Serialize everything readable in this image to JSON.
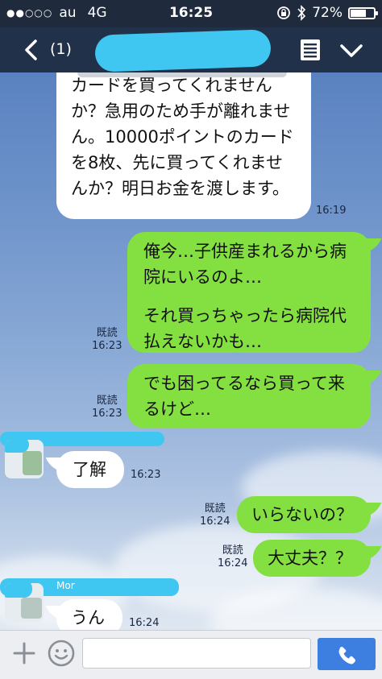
{
  "status_bar": {
    "signal_dots": "●●○○○",
    "carrier": "au",
    "network": "4G",
    "time": "16:25",
    "battery_percent": "72%",
    "battery_level": 0.72
  },
  "header": {
    "unread_count": "(1)"
  },
  "messages": [
    {
      "side": "in",
      "text": "カードを買ってくれませんか？急用のため手が離れません。10000ポイントのカードを8枚、先に買ってくれませんか？明日お金を渡します。",
      "time": "16:19"
    },
    {
      "side": "out",
      "line1": "俺今…子供産まれるから病院にいるのよ…",
      "line2": "それ買っちゃったら病院代払えないかも…",
      "read": "既読",
      "time": "16:23"
    },
    {
      "side": "out",
      "text": "でも困ってるなら買って来るけど…",
      "read": "既読",
      "time": "16:23"
    },
    {
      "side": "in",
      "text": "了解",
      "time": "16:23"
    },
    {
      "side": "out",
      "text": "いらないの？",
      "read": "既読",
      "time": "16:24"
    },
    {
      "side": "out",
      "text": "大丈夫？？",
      "read": "既読",
      "time": "16:24"
    },
    {
      "side": "in",
      "text": "うん",
      "time": "16:24"
    }
  ],
  "sender_name_fragment": "Mor",
  "input": {
    "value": "",
    "placeholder": ""
  },
  "colors": {
    "header_bg": "#22314a",
    "outgoing_bubble": "#84e041",
    "incoming_bubble": "#ffffff",
    "redaction": "#3fc7f2",
    "call_button": "#3d7fe0"
  },
  "icons": {
    "back": "chevron-left-icon",
    "note": "note-icon",
    "menu": "chevron-down-icon",
    "plus": "plus-icon",
    "emoji": "smiley-icon",
    "call": "phone-icon"
  }
}
